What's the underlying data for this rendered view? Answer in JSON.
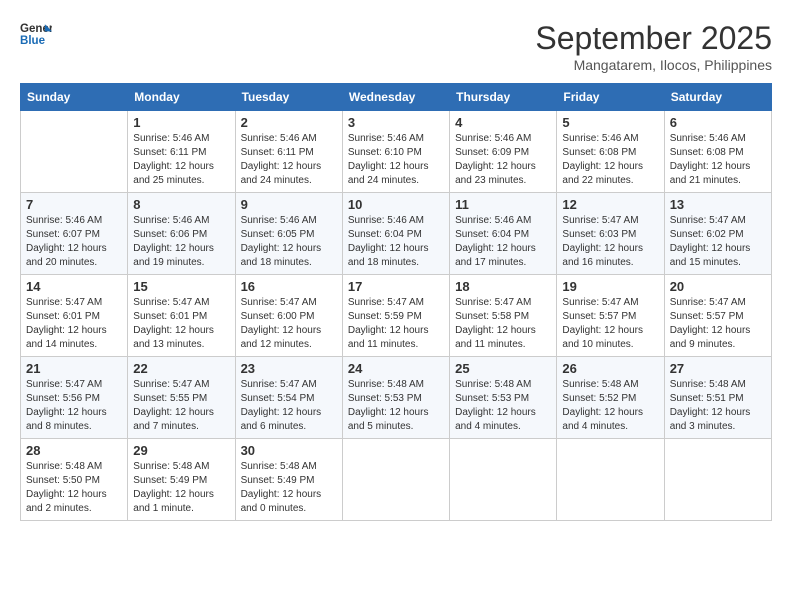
{
  "header": {
    "logo_line1": "General",
    "logo_line2": "Blue",
    "month": "September 2025",
    "location": "Mangatarem, Ilocos, Philippines"
  },
  "columns": [
    "Sunday",
    "Monday",
    "Tuesday",
    "Wednesday",
    "Thursday",
    "Friday",
    "Saturday"
  ],
  "weeks": [
    [
      {
        "day": "",
        "info": ""
      },
      {
        "day": "1",
        "info": "Sunrise: 5:46 AM\nSunset: 6:11 PM\nDaylight: 12 hours\nand 25 minutes."
      },
      {
        "day": "2",
        "info": "Sunrise: 5:46 AM\nSunset: 6:11 PM\nDaylight: 12 hours\nand 24 minutes."
      },
      {
        "day": "3",
        "info": "Sunrise: 5:46 AM\nSunset: 6:10 PM\nDaylight: 12 hours\nand 24 minutes."
      },
      {
        "day": "4",
        "info": "Sunrise: 5:46 AM\nSunset: 6:09 PM\nDaylight: 12 hours\nand 23 minutes."
      },
      {
        "day": "5",
        "info": "Sunrise: 5:46 AM\nSunset: 6:08 PM\nDaylight: 12 hours\nand 22 minutes."
      },
      {
        "day": "6",
        "info": "Sunrise: 5:46 AM\nSunset: 6:08 PM\nDaylight: 12 hours\nand 21 minutes."
      }
    ],
    [
      {
        "day": "7",
        "info": "Sunrise: 5:46 AM\nSunset: 6:07 PM\nDaylight: 12 hours\nand 20 minutes."
      },
      {
        "day": "8",
        "info": "Sunrise: 5:46 AM\nSunset: 6:06 PM\nDaylight: 12 hours\nand 19 minutes."
      },
      {
        "day": "9",
        "info": "Sunrise: 5:46 AM\nSunset: 6:05 PM\nDaylight: 12 hours\nand 18 minutes."
      },
      {
        "day": "10",
        "info": "Sunrise: 5:46 AM\nSunset: 6:04 PM\nDaylight: 12 hours\nand 18 minutes."
      },
      {
        "day": "11",
        "info": "Sunrise: 5:46 AM\nSunset: 6:04 PM\nDaylight: 12 hours\nand 17 minutes."
      },
      {
        "day": "12",
        "info": "Sunrise: 5:47 AM\nSunset: 6:03 PM\nDaylight: 12 hours\nand 16 minutes."
      },
      {
        "day": "13",
        "info": "Sunrise: 5:47 AM\nSunset: 6:02 PM\nDaylight: 12 hours\nand 15 minutes."
      }
    ],
    [
      {
        "day": "14",
        "info": "Sunrise: 5:47 AM\nSunset: 6:01 PM\nDaylight: 12 hours\nand 14 minutes."
      },
      {
        "day": "15",
        "info": "Sunrise: 5:47 AM\nSunset: 6:01 PM\nDaylight: 12 hours\nand 13 minutes."
      },
      {
        "day": "16",
        "info": "Sunrise: 5:47 AM\nSunset: 6:00 PM\nDaylight: 12 hours\nand 12 minutes."
      },
      {
        "day": "17",
        "info": "Sunrise: 5:47 AM\nSunset: 5:59 PM\nDaylight: 12 hours\nand 11 minutes."
      },
      {
        "day": "18",
        "info": "Sunrise: 5:47 AM\nSunset: 5:58 PM\nDaylight: 12 hours\nand 11 minutes."
      },
      {
        "day": "19",
        "info": "Sunrise: 5:47 AM\nSunset: 5:57 PM\nDaylight: 12 hours\nand 10 minutes."
      },
      {
        "day": "20",
        "info": "Sunrise: 5:47 AM\nSunset: 5:57 PM\nDaylight: 12 hours\nand 9 minutes."
      }
    ],
    [
      {
        "day": "21",
        "info": "Sunrise: 5:47 AM\nSunset: 5:56 PM\nDaylight: 12 hours\nand 8 minutes."
      },
      {
        "day": "22",
        "info": "Sunrise: 5:47 AM\nSunset: 5:55 PM\nDaylight: 12 hours\nand 7 minutes."
      },
      {
        "day": "23",
        "info": "Sunrise: 5:47 AM\nSunset: 5:54 PM\nDaylight: 12 hours\nand 6 minutes."
      },
      {
        "day": "24",
        "info": "Sunrise: 5:48 AM\nSunset: 5:53 PM\nDaylight: 12 hours\nand 5 minutes."
      },
      {
        "day": "25",
        "info": "Sunrise: 5:48 AM\nSunset: 5:53 PM\nDaylight: 12 hours\nand 4 minutes."
      },
      {
        "day": "26",
        "info": "Sunrise: 5:48 AM\nSunset: 5:52 PM\nDaylight: 12 hours\nand 4 minutes."
      },
      {
        "day": "27",
        "info": "Sunrise: 5:48 AM\nSunset: 5:51 PM\nDaylight: 12 hours\nand 3 minutes."
      }
    ],
    [
      {
        "day": "28",
        "info": "Sunrise: 5:48 AM\nSunset: 5:50 PM\nDaylight: 12 hours\nand 2 minutes."
      },
      {
        "day": "29",
        "info": "Sunrise: 5:48 AM\nSunset: 5:49 PM\nDaylight: 12 hours\nand 1 minute."
      },
      {
        "day": "30",
        "info": "Sunrise: 5:48 AM\nSunset: 5:49 PM\nDaylight: 12 hours\nand 0 minutes."
      },
      {
        "day": "",
        "info": ""
      },
      {
        "day": "",
        "info": ""
      },
      {
        "day": "",
        "info": ""
      },
      {
        "day": "",
        "info": ""
      }
    ]
  ]
}
